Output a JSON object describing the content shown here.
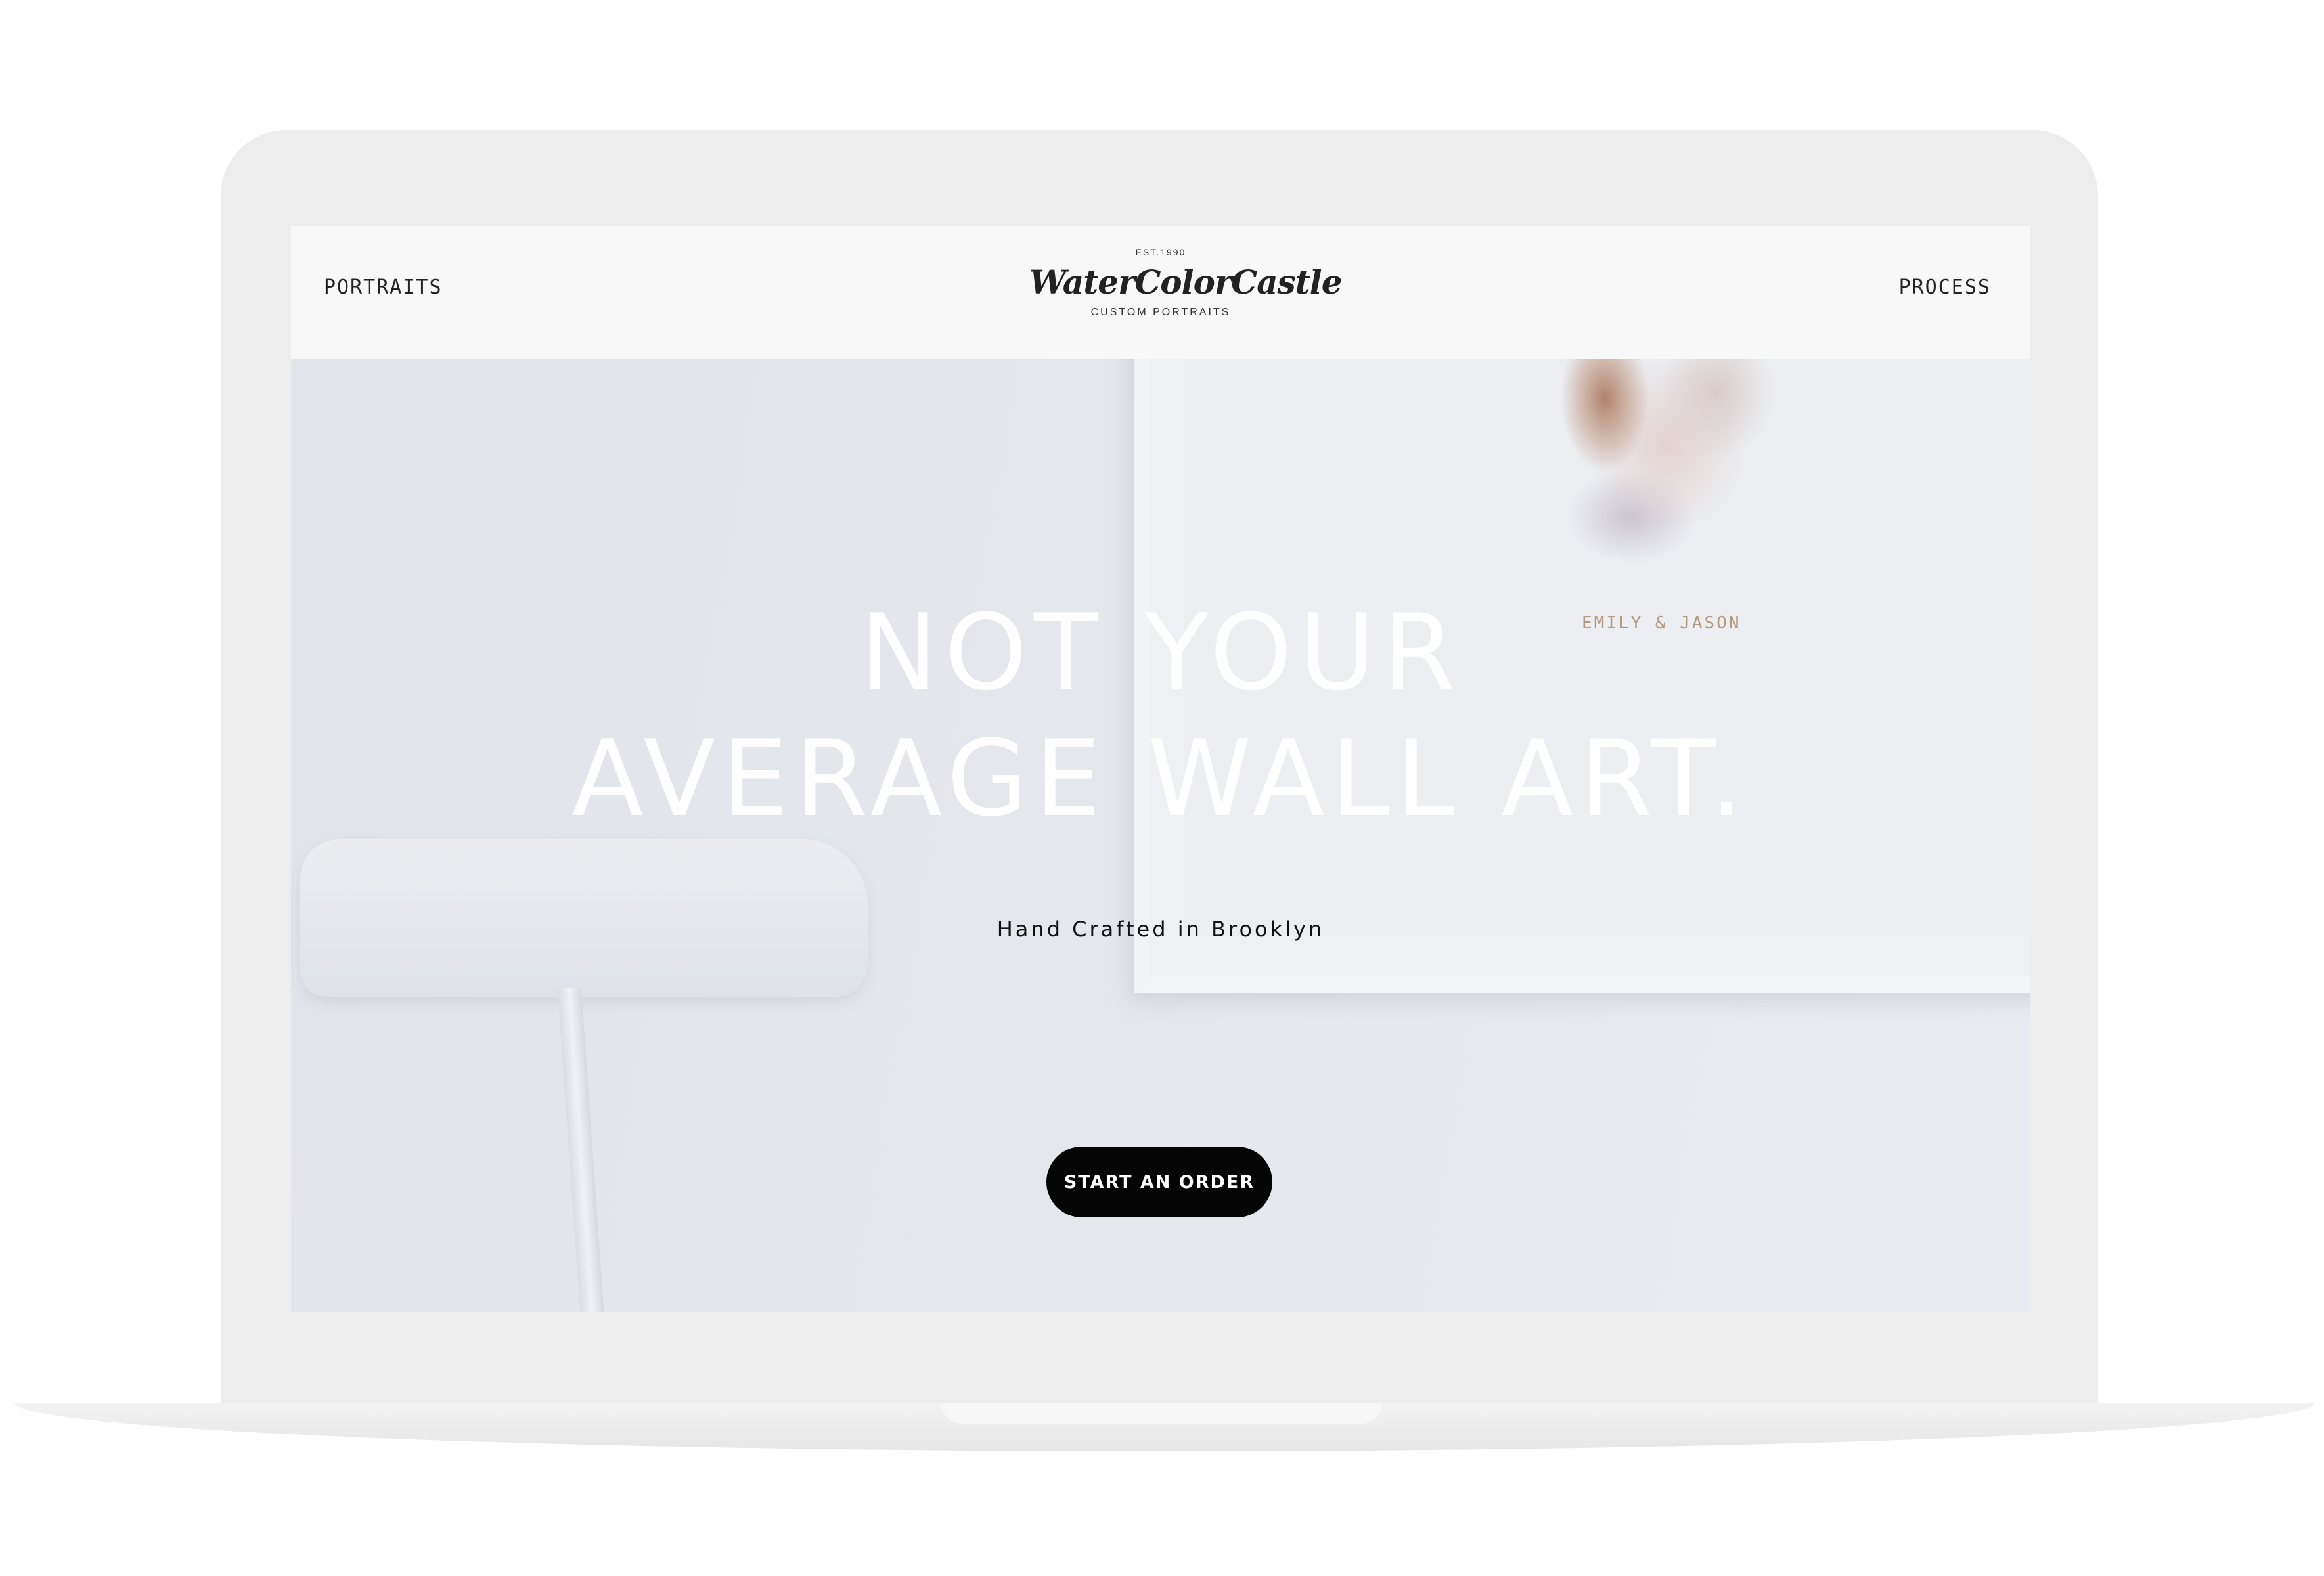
{
  "header": {
    "nav_left_label": "PORTRAITS",
    "nav_right_label": "PROCESS",
    "logo": {
      "est": "EST.1990",
      "name": "WaterColorCastle",
      "tagline": "CUSTOM PORTRAITS"
    }
  },
  "hero": {
    "headline_line1": "NOT YOUR",
    "headline_line2": "AVERAGE WALL ART.",
    "subtitle": "Hand Crafted in Brooklyn",
    "cta_label": "START AN ORDER",
    "artwork_caption": "EMILY & JASON"
  },
  "colors": {
    "header_background": "#f8f8f8",
    "hero_background": "#e3e6ea",
    "cta_background": "#050505",
    "cta_text": "#ffffff",
    "headline_text": "#ffffff",
    "device_frame": "#ededed"
  }
}
